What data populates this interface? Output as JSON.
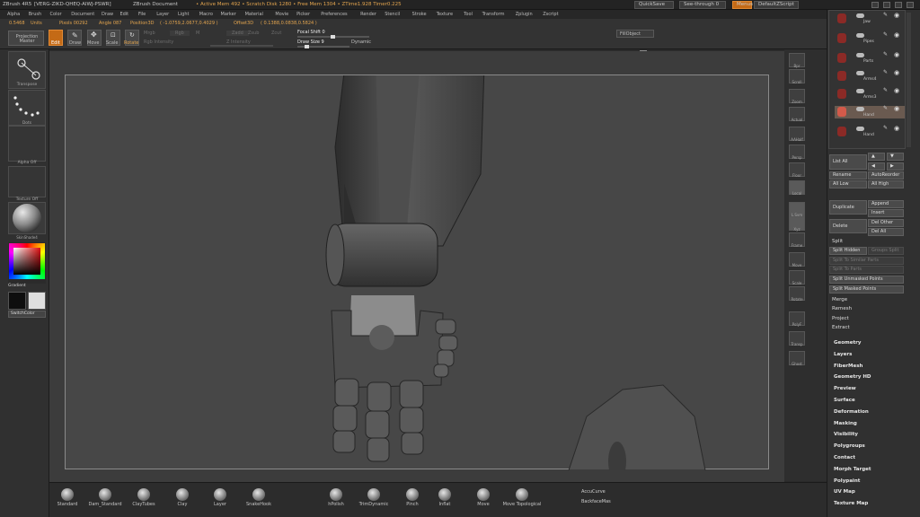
{
  "titlebar": {
    "app": "ZBrush 4R5",
    "build": "[VERG-ZIKD-QHEQ-AIWJ-PSWR]",
    "doc": "ZBrush Document",
    "stats": "• Active Mem 492 • Scratch Disk 1280 • Free Mem 1304 • ZTime1.928 Timer0.225",
    "quicksave": "QuickSave",
    "seethrough": "See-through",
    "seethrough_value": "0",
    "menus": "Menus",
    "script": "DefaultZScript"
  },
  "menubar": [
    "Alpha",
    "Brush",
    "Color",
    "Document",
    "Draw",
    "Edit",
    "File",
    "Layer",
    "Light",
    "Macro",
    "Marker",
    "Material",
    "Movie",
    "Picker",
    "Preferences",
    "Render",
    "Stencil",
    "Stroke",
    "Texture",
    "Tool",
    "Transform",
    "Zplugin",
    "Zscript"
  ],
  "infobar": {
    "units_value": "0.5468",
    "units": "Units",
    "pixols": "Pixols 00292",
    "angle": "Angle 087",
    "position_label": "Position3D",
    "position": "( -1.0759,2.0677,0.4029 )",
    "offset_label": "Offset3D",
    "offset": "( 0.1388,0.0838,0.5824 )"
  },
  "shelf": {
    "projection_master": "Projection Master",
    "edit": "Edit",
    "draw": "Draw",
    "move": "Move",
    "scale": "Scale",
    "rotate": "Rotate",
    "mrgb": "Mrgb",
    "rgb": "Rgb",
    "m": "M",
    "zadd": "Zadd",
    "zsub": "Zsub",
    "zcut": "Zcut",
    "rgb_intensity": "Rgb Intensity",
    "z_intensity": "Z Intensity",
    "focal_shift": "Focal Shift 0",
    "draw_size": "Draw Size 9",
    "dynamic": "Dynamic",
    "fill_object": "FillObject"
  },
  "lefttray": {
    "transpose": "Transpose",
    "dots": "Dots",
    "alpha_off": "Alpha Off",
    "texture_off": "Texture Off",
    "matcap": "SkinShade4",
    "gradient": "Gradient",
    "switch_color": "SwitchColor"
  },
  "rightshelf": [
    "Bpr",
    "Scroll",
    "Zoom",
    "Actual",
    "AAHalf",
    "Persp",
    "Floor",
    "Local",
    "L.Sym",
    "Xyz",
    "Frame",
    "Move",
    "Scale",
    "Rotate",
    "PolyF",
    "Transp",
    "Ghost"
  ],
  "subtool": {
    "items": [
      {
        "name": "Jaw",
        "selected": false
      },
      {
        "name": "Pipes",
        "selected": false
      },
      {
        "name": "Parts",
        "selected": false
      },
      {
        "name": "Arms4",
        "selected": false
      },
      {
        "name": "Arms3",
        "selected": false
      },
      {
        "name": "Hand",
        "selected": true
      },
      {
        "name": "Hand",
        "selected": false
      }
    ]
  },
  "palette": {
    "list_all": "List All",
    "rename": "Rename",
    "auto_reorder": "AutoReorder",
    "all_low": "All Low",
    "all_high": "All High",
    "duplicate": "Duplicate",
    "append": "Append",
    "insert": "Insert",
    "delete": "Delete",
    "del_other": "Del Other",
    "del_all": "Del All",
    "split_label": "Split",
    "split_hidden": "Split Hidden",
    "groups_split": "Groups Split",
    "split_polygroups": "Split To Similar Parts",
    "split_to_parts": "Split To Parts",
    "split_unmasked": "Split Unmasked Points",
    "split_masked": "Split Masked Points",
    "merge": "Merge",
    "remesh": "Remesh",
    "project": "Project",
    "extract": "Extract",
    "sections": [
      "Geometry",
      "Layers",
      "FiberMesh",
      "Geometry HD",
      "Preview",
      "Surface",
      "Deformation",
      "Masking",
      "Visibility",
      "Polygroups",
      "Contact",
      "Morph Target",
      "Polypaint",
      "UV Map",
      "Texture Map"
    ]
  },
  "bottom": {
    "brushes": [
      "Standard",
      "Dam_Standard",
      "ClayTubes",
      "Clay",
      "Layer",
      "SnakeHook",
      "hPolish",
      "TrimDynamic",
      "Pinch",
      "Inflat",
      "Move",
      "Move Topological"
    ],
    "accucurve": "AccuCurve",
    "backfacemask": "BackfaceMas"
  },
  "colors": {
    "accent": "#c46a16",
    "viewport": "#474747",
    "selected_subtool": "#6a5a50"
  }
}
